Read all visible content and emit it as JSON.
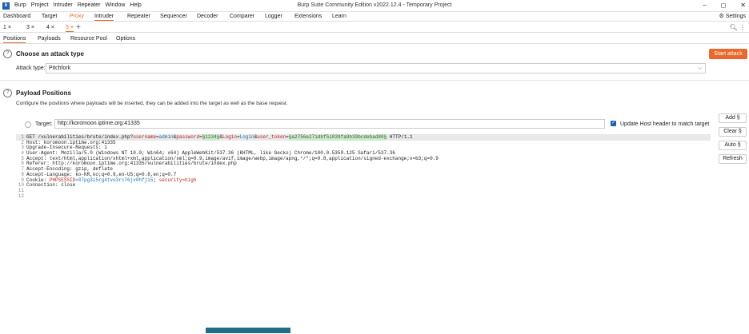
{
  "window": {
    "title": "Burp Suite Community Edition v2022.12.4 - Temporary Project",
    "logo": "b",
    "menu": [
      "Burp",
      "Project",
      "Intruder",
      "Repeater",
      "Window",
      "Help"
    ],
    "controls": [
      "–",
      "◻",
      "✕"
    ]
  },
  "top_tabs": [
    "Dashboard",
    "Target",
    "Proxy",
    "Intruder",
    "Repeater",
    "Sequencer",
    "Decoder",
    "Comparer",
    "Logger",
    "Extensions",
    "Learn"
  ],
  "settings_label": "Settings",
  "sub_tabs": [
    "1 ×",
    "3 ×",
    "4 ×",
    "5 ×"
  ],
  "plus": "+",
  "position_tabs": [
    "Positions",
    "Payloads",
    "Resource Pool",
    "Options"
  ],
  "attack": {
    "heading": "Choose an attack type",
    "start_label": "Start attack",
    "type_label": "Attack type:",
    "type_value": "Pitchfork"
  },
  "payload_positions": {
    "heading": "Payload Positions",
    "description": "Configure the positions where payloads will be inserted, they can be added into the target as well as the base request.",
    "target_label": "Target:",
    "target_value": "http://koromoon.iptime.org:41335",
    "update_host_label": "Update Host header to match target"
  },
  "side_buttons": [
    "Add §",
    "Clear §",
    "Auto §",
    "Refresh"
  ],
  "request": {
    "line1": {
      "prefix": "GET /vulnerabilities/brute/index.php?",
      "username_key": "username",
      "username_val": "admin",
      "amp1": "&",
      "password_key": "password",
      "password_eq": "=",
      "password_payload": "§1234§",
      "amp2": "&",
      "login_key": "Login",
      "login_eq": "=",
      "login_val": "Login",
      "amp3": "&",
      "token_key": "user_token",
      "token_eq": "=",
      "token_payload": "§a2756e27idbf5i039fa9b39bcdebad80§",
      "suffix": " HTTP/1.1"
    },
    "lines": [
      "Host: koromoon.iptime.org:41335",
      "Upgrade-Insecure-Requests: 1",
      "User-Agent: Mozilla/5.0 (Windows NT 10.0; Win64; x64) AppleWebKit/537.36 (KHTML, like Gecko) Chrome/100.0.5359.125 Safari/537.36",
      "Accept: text/html,application/xhtml+xml,application/xml;q=0.9,image/avif,image/webp,image/apng,*/*;q=0.8,application/signed-exchange;v=b3;q=0.9",
      "Referer: http://koromoon.iptime.org:41335/vulnerabilities/brute/index.php",
      "Accept-Encoding: gzip, deflate",
      "Accept-Language: ko-KR,ko;q=0.9,en-US;q=0.8,en;q=0.7"
    ],
    "cookie": {
      "prefix": "Cookie: ",
      "phpsessid_key": "PHPSESSID",
      "phpsessid_val": "=07pg3i5rg4tvu3rc76jv0hfji5",
      "sep": "; ",
      "security_key": "security",
      "security_val": "=high"
    },
    "connection": "Connection: close",
    "line_numbers": [
      "1",
      "2",
      "3",
      "4",
      "5",
      "6",
      "7",
      "8",
      "9",
      "10",
      "11",
      "12"
    ]
  },
  "colors": {
    "accent": "#e8692b",
    "brand": "#1f5fb0"
  }
}
